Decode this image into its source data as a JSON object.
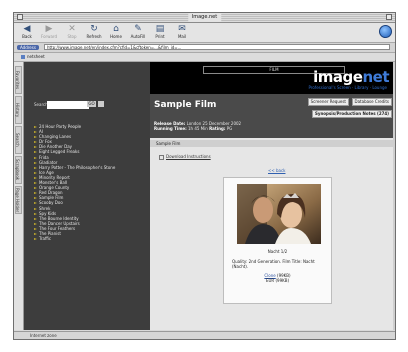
{
  "window": {
    "title": "Image.net"
  },
  "toolbar": {
    "buttons": [
      {
        "label": "Back",
        "icon": "back-arrow-icon",
        "glyph": "◀",
        "enabled": true
      },
      {
        "label": "Forward",
        "icon": "forward-arrow-icon",
        "glyph": "▶",
        "enabled": false
      },
      {
        "label": "Stop",
        "icon": "stop-icon",
        "glyph": "✕",
        "enabled": false
      },
      {
        "label": "Refresh",
        "icon": "refresh-icon",
        "glyph": "↻",
        "enabled": true
      },
      {
        "label": "Home",
        "icon": "home-icon",
        "glyph": "⌂",
        "enabled": true
      },
      {
        "label": "AutoFill",
        "icon": "autofill-icon",
        "glyph": "✎",
        "enabled": true
      },
      {
        "label": "Print",
        "icon": "print-icon",
        "glyph": "▤",
        "enabled": true
      },
      {
        "label": "Mail",
        "icon": "mail-icon",
        "glyph": "✉",
        "enabled": true
      }
    ]
  },
  "address": {
    "label": "Address",
    "url": "http://www.image.net/en/index.cfm?cfid=1&cftoken=...&film_id=..."
  },
  "favorites": {
    "label": "netsheet"
  },
  "side_tabs": [
    "Favorites",
    "History",
    "Search",
    "Scrapbook",
    "Page Holder"
  ],
  "banner": {
    "film_label": "FILM",
    "logo_main": "image",
    "logo_accent": "net",
    "tagline": "Professional's Screen · Library · Lounge"
  },
  "sidebar": {
    "search_label": "Search",
    "search_value": "",
    "go_label": "GO",
    "films": [
      "24 Hour Party People",
      "AI",
      "Changing Lanes",
      "Dr Fox",
      "Die Another Day",
      "Eight Legged Freaks",
      "Frida",
      "Gladiator",
      "Harry Potter - The Philosopher's Stone",
      "Ice Age",
      "Minority Report",
      "Monster's Ball",
      "Orange County",
      "Red Dragon",
      "Sample Film",
      "Scooby Doo",
      "Shrek",
      "Spy Kids",
      "The Bourne Identity",
      "The Dancer Upstairs",
      "The Four Feathers",
      "The Pianist",
      "Traffic"
    ]
  },
  "main": {
    "title": "Sample Film",
    "actions": [
      "Screener Request",
      "Database Credits",
      "Synopsis/Production Notes (274)"
    ],
    "release_label": "Release Date:",
    "release_value": "London 25 December 2002",
    "runtime_label": "Running Time:",
    "runtime_value": "1h 45 Min",
    "rating_label": "Rating:",
    "rating_value": "PG",
    "section": "Sample Film",
    "download": "Download Instructions",
    "back": "<< back",
    "image_caption": "Nacht 1/2",
    "quality": "Quality: 2nd Generation. Film Title: Nacht (Nacht).",
    "price_link": "Clone",
    "price_link_suffix": "(99KB)",
    "price_line2": "EUR (99KB)"
  },
  "status": {
    "text": "Internet zone"
  }
}
